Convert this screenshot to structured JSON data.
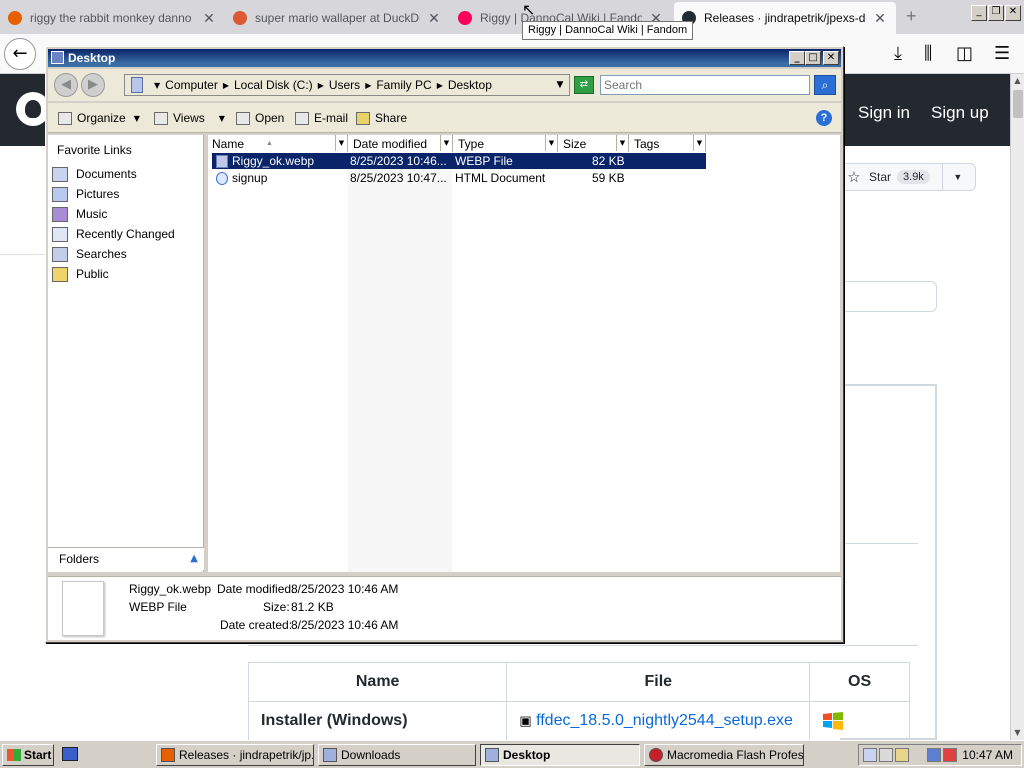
{
  "browser": {
    "tabs": [
      {
        "title": "riggy the rabbit monkey danno at",
        "fav_color": "#e66000"
      },
      {
        "title": "super mario wallaper at DuckDuck",
        "fav_color": "#de5833"
      },
      {
        "title": "Riggy | DannoCal Wiki | Fandom",
        "fav_color": "#fa005a"
      },
      {
        "title": "Releases · jindrapetrik/jpexs-deco",
        "fav_color": "#24292f"
      }
    ],
    "tooltip": "Riggy | DannoCal Wiki | Fandom",
    "back_icon": "arrow-left-icon",
    "new_tab": "+"
  },
  "github": {
    "sign_in": "Sign in",
    "sign_up": "Sign up",
    "star_label": "Star",
    "star_count": "3.9k",
    "table": {
      "headers": [
        "Name",
        "File",
        "OS"
      ],
      "rows": [
        {
          "name": "Installer (Windows)",
          "file": "ffdec_18.5.0_nightly2544_setup.exe",
          "os_icon": "windows-flag-icon"
        }
      ]
    }
  },
  "explorer": {
    "title": "Desktop",
    "breadcrumbs": [
      "Computer",
      "Local Disk (C:)",
      "Users",
      "Family PC",
      "Desktop"
    ],
    "search_placeholder": "Search",
    "commands": [
      "Organize",
      "Views",
      "Open",
      "E-mail",
      "Share"
    ],
    "favorite_links_title": "Favorite Links",
    "favorite_links": [
      "Documents",
      "Pictures",
      "Music",
      "Recently Changed",
      "Searches",
      "Public"
    ],
    "folders_label": "Folders",
    "columns": [
      "Name",
      "Date modified",
      "Type",
      "Size",
      "Tags"
    ],
    "files": [
      {
        "name": "Riggy_ok.webp",
        "modified": "8/25/2023 10:46...",
        "type": "WEBP File",
        "size": "82 KB",
        "selected": true
      },
      {
        "name": "signup",
        "modified": "8/25/2023 10:47...",
        "type": "HTML Document",
        "size": "59 KB",
        "selected": false
      }
    ],
    "details": {
      "filename": "Riggy_ok.webp",
      "filetype": "WEBP File",
      "modified_label": "Date modified:",
      "modified": "8/25/2023 10:46 AM",
      "size_label": "Size:",
      "size": "81.2 KB",
      "created_label": "Date created:",
      "created": "8/25/2023 10:46 AM"
    }
  },
  "taskbar": {
    "start": "Start",
    "tasks": [
      {
        "label": "Releases · jindrapetrik/jp...",
        "active": false
      },
      {
        "label": "Downloads",
        "active": false
      },
      {
        "label": "Desktop",
        "active": true
      },
      {
        "label": "Macromedia Flash Profes...",
        "active": false
      }
    ],
    "clock": "10:47 AM"
  }
}
